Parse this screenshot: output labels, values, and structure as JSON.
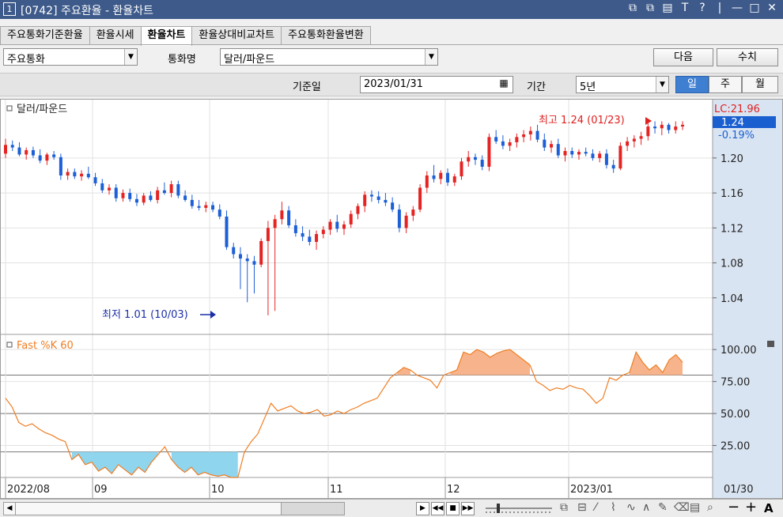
{
  "window": {
    "num": "1",
    "title": "[0742] 주요환율 - 환율차트",
    "buttons": [
      "⧉",
      "⧉",
      "▤",
      "T",
      "?",
      "|",
      "—",
      "□",
      "✕"
    ]
  },
  "tabs": [
    "주요통화기준환율",
    "환율시세",
    "환율차트",
    "환율상대비교차트",
    "주요통화환율변환"
  ],
  "active_tab": "환율차트",
  "filter": {
    "category_value": "주요통화",
    "currency_label": "통화명",
    "currency_value": "달러/파운드",
    "next_label": "다음",
    "lookup_label": "수치"
  },
  "period": {
    "date_label": "기준일",
    "date_value": "2023/01/31",
    "range_label": "기간",
    "range_value": "5년",
    "seg": [
      "일",
      "주",
      "월"
    ],
    "seg_active": "일"
  },
  "chart_data": [
    {
      "type": "candlestick",
      "legend": "달러/파운드",
      "y_ticks": [
        "1.20",
        "1.16",
        "1.12",
        "1.08",
        "1.04"
      ],
      "current_value": "1.24",
      "change": "-0.19%",
      "lc_label": "LC:21.96",
      "high_note": "최고 1.24 (01/23)",
      "low_note": "최저 1.01 (10/03)",
      "ylim": [
        1.0,
        1.265
      ],
      "x_labels": [
        "2022/08",
        "09",
        "10",
        "11",
        "12",
        "2023/01",
        "01/30"
      ],
      "candles": [
        [
          1.205,
          1.222,
          1.2,
          1.215
        ],
        [
          1.215,
          1.22,
          1.208,
          1.212
        ],
        [
          1.212,
          1.218,
          1.202,
          1.204
        ],
        [
          1.204,
          1.212,
          1.198,
          1.209
        ],
        [
          1.209,
          1.213,
          1.2,
          1.203
        ],
        [
          1.203,
          1.21,
          1.194,
          1.197
        ],
        [
          1.197,
          1.206,
          1.192,
          1.204
        ],
        [
          1.204,
          1.208,
          1.198,
          1.201
        ],
        [
          1.201,
          1.205,
          1.175,
          1.18
        ],
        [
          1.18,
          1.188,
          1.175,
          1.184
        ],
        [
          1.184,
          1.188,
          1.176,
          1.179
        ],
        [
          1.179,
          1.186,
          1.174,
          1.182
        ],
        [
          1.182,
          1.19,
          1.176,
          1.178
        ],
        [
          1.178,
          1.183,
          1.168,
          1.171
        ],
        [
          1.171,
          1.176,
          1.16,
          1.163
        ],
        [
          1.163,
          1.17,
          1.158,
          1.166
        ],
        [
          1.166,
          1.17,
          1.15,
          1.154
        ],
        [
          1.154,
          1.164,
          1.15,
          1.16
        ],
        [
          1.16,
          1.165,
          1.15,
          1.153
        ],
        [
          1.153,
          1.159,
          1.145,
          1.149
        ],
        [
          1.149,
          1.16,
          1.146,
          1.157
        ],
        [
          1.157,
          1.162,
          1.15,
          1.152
        ],
        [
          1.152,
          1.167,
          1.148,
          1.163
        ],
        [
          1.163,
          1.172,
          1.158,
          1.16
        ],
        [
          1.16,
          1.174,
          1.155,
          1.17
        ],
        [
          1.17,
          1.174,
          1.154,
          1.157
        ],
        [
          1.157,
          1.163,
          1.15,
          1.152
        ],
        [
          1.152,
          1.158,
          1.142,
          1.145
        ],
        [
          1.145,
          1.152,
          1.14,
          1.143
        ],
        [
          1.143,
          1.15,
          1.138,
          1.146
        ],
        [
          1.146,
          1.15,
          1.138,
          1.141
        ],
        [
          1.141,
          1.147,
          1.13,
          1.133
        ],
        [
          1.133,
          1.14,
          1.095,
          1.098
        ],
        [
          1.098,
          1.103,
          1.085,
          1.09
        ],
        [
          1.09,
          1.098,
          1.05,
          1.085
        ],
        [
          1.085,
          1.09,
          1.035,
          1.082
        ],
        [
          1.082,
          1.088,
          1.045,
          1.078
        ],
        [
          1.078,
          1.108,
          1.075,
          1.105
        ],
        [
          1.105,
          1.128,
          1.02,
          1.12
        ],
        [
          1.12,
          1.135,
          1.025,
          1.13
        ],
        [
          1.13,
          1.15,
          1.124,
          1.14
        ],
        [
          1.14,
          1.145,
          1.12,
          1.123
        ],
        [
          1.123,
          1.13,
          1.11,
          1.114
        ],
        [
          1.114,
          1.122,
          1.105,
          1.11
        ],
        [
          1.11,
          1.118,
          1.1,
          1.104
        ],
        [
          1.104,
          1.117,
          1.095,
          1.113
        ],
        [
          1.113,
          1.122,
          1.108,
          1.118
        ],
        [
          1.118,
          1.13,
          1.112,
          1.127
        ],
        [
          1.127,
          1.135,
          1.115,
          1.119
        ],
        [
          1.119,
          1.128,
          1.112,
          1.124
        ],
        [
          1.124,
          1.14,
          1.12,
          1.136
        ],
        [
          1.136,
          1.148,
          1.13,
          1.145
        ],
        [
          1.145,
          1.162,
          1.138,
          1.158
        ],
        [
          1.158,
          1.163,
          1.15,
          1.156
        ],
        [
          1.156,
          1.162,
          1.148,
          1.152
        ],
        [
          1.152,
          1.16,
          1.145,
          1.149
        ],
        [
          1.149,
          1.155,
          1.138,
          1.141
        ],
        [
          1.141,
          1.147,
          1.115,
          1.12
        ],
        [
          1.12,
          1.138,
          1.114,
          1.134
        ],
        [
          1.134,
          1.145,
          1.128,
          1.141
        ],
        [
          1.141,
          1.17,
          1.138,
          1.166
        ],
        [
          1.166,
          1.185,
          1.16,
          1.18
        ],
        [
          1.18,
          1.192,
          1.172,
          1.176
        ],
        [
          1.176,
          1.186,
          1.17,
          1.183
        ],
        [
          1.183,
          1.188,
          1.168,
          1.172
        ],
        [
          1.172,
          1.182,
          1.168,
          1.179
        ],
        [
          1.179,
          1.2,
          1.175,
          1.196
        ],
        [
          1.196,
          1.208,
          1.19,
          1.201
        ],
        [
          1.201,
          1.205,
          1.192,
          1.198
        ],
        [
          1.198,
          1.203,
          1.186,
          1.19
        ],
        [
          1.19,
          1.228,
          1.185,
          1.224
        ],
        [
          1.224,
          1.232,
          1.216,
          1.219
        ],
        [
          1.219,
          1.226,
          1.21,
          1.214
        ],
        [
          1.214,
          1.222,
          1.208,
          1.218
        ],
        [
          1.218,
          1.228,
          1.212,
          1.224
        ],
        [
          1.224,
          1.232,
          1.218,
          1.227
        ],
        [
          1.227,
          1.236,
          1.22,
          1.231
        ],
        [
          1.231,
          1.238,
          1.218,
          1.221
        ],
        [
          1.221,
          1.228,
          1.208,
          1.212
        ],
        [
          1.212,
          1.22,
          1.206,
          1.216
        ],
        [
          1.216,
          1.222,
          1.2,
          1.203
        ],
        [
          1.203,
          1.212,
          1.196,
          1.208
        ],
        [
          1.208,
          1.212,
          1.2,
          1.204
        ],
        [
          1.204,
          1.21,
          1.198,
          1.207
        ],
        [
          1.207,
          1.212,
          1.202,
          1.205
        ],
        [
          1.205,
          1.21,
          1.197,
          1.2
        ],
        [
          1.2,
          1.208,
          1.195,
          1.205
        ],
        [
          1.205,
          1.21,
          1.188,
          1.192
        ],
        [
          1.192,
          1.198,
          1.183,
          1.188
        ],
        [
          1.188,
          1.218,
          1.186,
          1.214
        ],
        [
          1.214,
          1.224,
          1.208,
          1.219
        ],
        [
          1.219,
          1.226,
          1.212,
          1.222
        ],
        [
          1.222,
          1.23,
          1.215,
          1.225
        ],
        [
          1.225,
          1.24,
          1.22,
          1.236
        ],
        [
          1.236,
          1.242,
          1.228,
          1.234
        ],
        [
          1.234,
          1.242,
          1.226,
          1.238
        ],
        [
          1.238,
          1.24,
          1.228,
          1.232
        ],
        [
          1.232,
          1.242,
          1.228,
          1.236
        ],
        [
          1.236,
          1.242,
          1.232,
          1.238
        ]
      ]
    },
    {
      "type": "line",
      "legend": "Fast %K 60",
      "y_ticks": [
        "100.00",
        "75.00",
        "50.00",
        "25.00"
      ],
      "ylim": [
        0,
        110
      ],
      "upper": 80,
      "lower": 20,
      "mid": 50,
      "values": [
        62,
        55,
        43,
        40,
        42,
        38,
        35,
        33,
        30,
        28,
        14,
        18,
        10,
        12,
        5,
        8,
        3,
        10,
        6,
        2,
        8,
        4,
        12,
        18,
        24,
        14,
        8,
        4,
        8,
        2,
        4,
        2,
        1,
        2,
        0,
        0,
        20,
        28,
        34,
        46,
        58,
        52,
        54,
        56,
        52,
        50,
        51,
        53,
        48,
        49,
        52,
        50,
        53,
        55,
        58,
        60,
        62,
        70,
        78,
        82,
        86,
        84,
        80,
        78,
        76,
        70,
        80,
        82,
        84,
        98,
        96,
        100,
        98,
        94,
        97,
        99,
        100,
        96,
        92,
        88,
        75,
        72,
        68,
        70,
        69,
        72,
        70,
        69,
        64,
        58,
        62,
        78,
        76,
        80,
        82,
        98,
        90,
        84,
        88,
        82,
        92,
        96,
        90
      ]
    }
  ],
  "toolbar": {
    "zoom_out": "−",
    "zoom_in": "+",
    "font": "A"
  }
}
